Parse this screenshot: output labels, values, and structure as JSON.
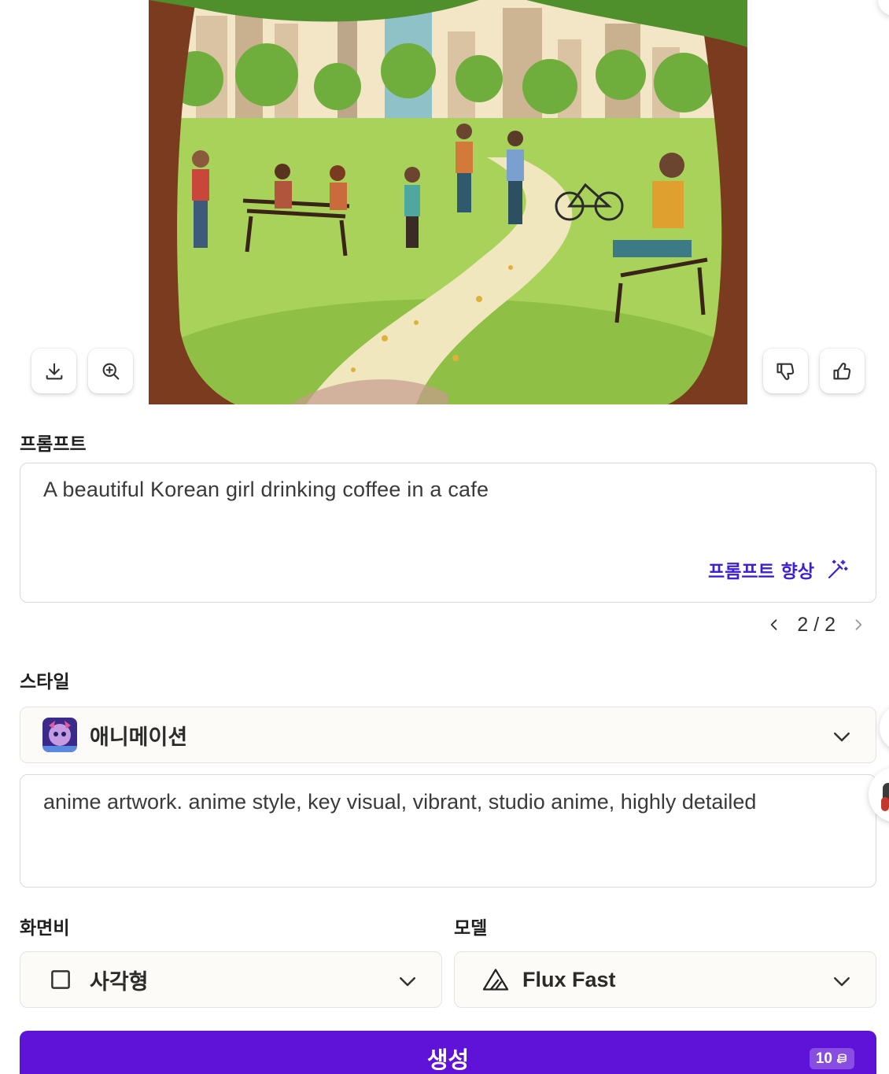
{
  "image": {
    "alt": "",
    "actions": {
      "download_icon": "download-icon",
      "zoom_icon": "zoom-in-icon",
      "dislike_icon": "thumbs-down-icon",
      "like_icon": "thumbs-up-icon"
    }
  },
  "prompt": {
    "label": "프롬프트",
    "value": "A beautiful Korean girl drinking coffee in a cafe",
    "enhance_label": "프롬프트 향상",
    "pager": {
      "current": "2",
      "separator": "/",
      "total": "2"
    }
  },
  "style": {
    "label": "스타일",
    "selected": "애니메이션",
    "description": "anime artwork. anime style, key visual, vibrant, studio anime, highly detailed"
  },
  "aspect_ratio": {
    "label": "화면비",
    "selected": "사각형"
  },
  "model": {
    "label": "모델",
    "selected": "Flux Fast"
  },
  "generate": {
    "label": "생성",
    "cost": "10"
  },
  "colors": {
    "accent": "#6013d8",
    "enhance_text": "#3d1fd6"
  }
}
